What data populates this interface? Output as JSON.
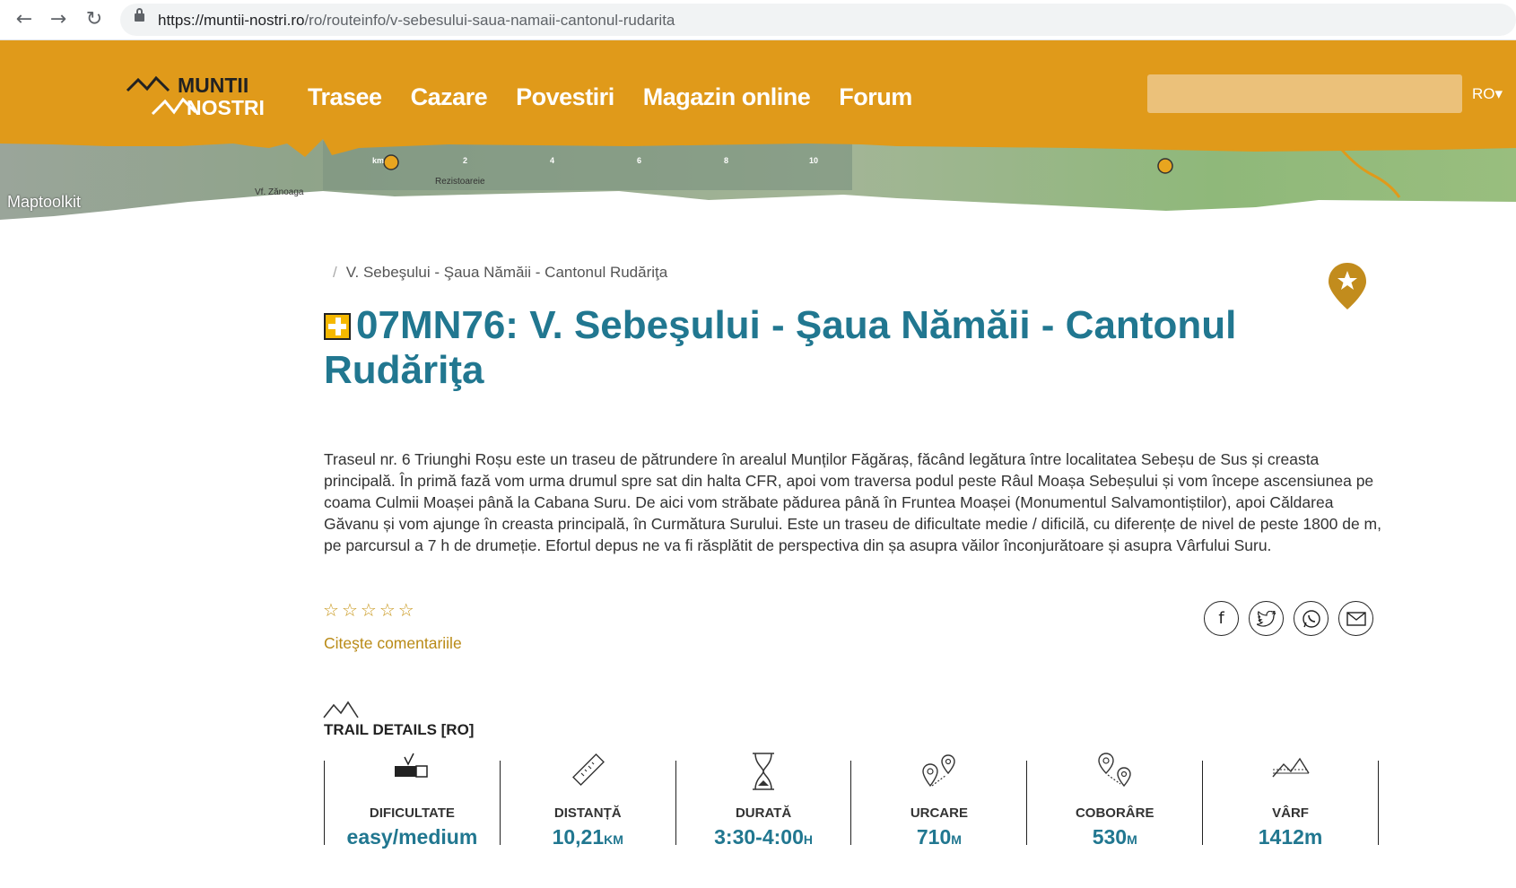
{
  "browser": {
    "url_host": "https://muntii-nostri.ro",
    "url_path": "/ro/routeinfo/v-sebesului-saua-namaii-cantonul-rudarita"
  },
  "header": {
    "logo_text_top": "MUNTII",
    "logo_text_bottom": "NOSTRI",
    "menu": [
      "Trasee",
      "Cazare",
      "Povestiri",
      "Magazin online",
      "Forum"
    ],
    "search_placeholder": "",
    "language": "RO",
    "map_credit": "Maptoolkit",
    "map_scale": [
      "km",
      "2",
      "4",
      "6",
      "8",
      "10"
    ],
    "map_labels": [
      "Vf. Zănoaga",
      "Rezistoareie"
    ]
  },
  "page": {
    "breadcrumb": "V. Sebeşului - Şaua Nămăii - Cantonul Rudăriţa",
    "title": "07MN76: V. Sebeşului - Şaua Nămăii - Cantonul Rudăriţa",
    "description": "Traseul nr. 6 Triunghi Roșu este un traseu de pătrundere în arealul Munților Făgăraș, făcând legătura între localitatea Sebeșu de Sus și creasta principală. În primă fază vom urma drumul spre sat din halta CFR, apoi vom traversa podul peste Râul Moașa Sebeșului și vom începe ascensiunea pe coama Culmii Moașei până la Cabana Suru. De aici vom străbate pădurea până în Fruntea Moașei (Monumentul Salvamontiștilor), apoi Căldarea Găvanu și vom ajunge în creasta principală, în Curmătura Surului. Este un traseu de dificultate medie / dificilă, cu diferențe de nivel de peste 1800 de m, pe parcursul a 7 h de drumeție. Efortul depus ne va fi răsplătit de perspectiva din șa asupra văilor înconjurătoare și asupra Vârfului Suru.",
    "rating_stars": 0,
    "read_comments": "Citeşte comentariile"
  },
  "trail_details": {
    "heading": "TRAIL DETAILS [RO]",
    "items": [
      {
        "label": "DIFICULTATE",
        "value": "easy/medium",
        "unit": ""
      },
      {
        "label": "DISTANȚĂ",
        "value": "10,21",
        "unit": "KM"
      },
      {
        "label": "DURATĂ",
        "value": "3:30-4:00",
        "unit": "H"
      },
      {
        "label": "URCARE",
        "value": "710",
        "unit": "M"
      },
      {
        "label": "COBORÂRE",
        "value": "530",
        "unit": "M"
      },
      {
        "label": "VÂRF",
        "value": "1412m",
        "unit": ""
      }
    ]
  },
  "colors": {
    "brand_orange": "#e09a1a",
    "title_teal": "#217790",
    "link_gold": "#b98a16"
  }
}
